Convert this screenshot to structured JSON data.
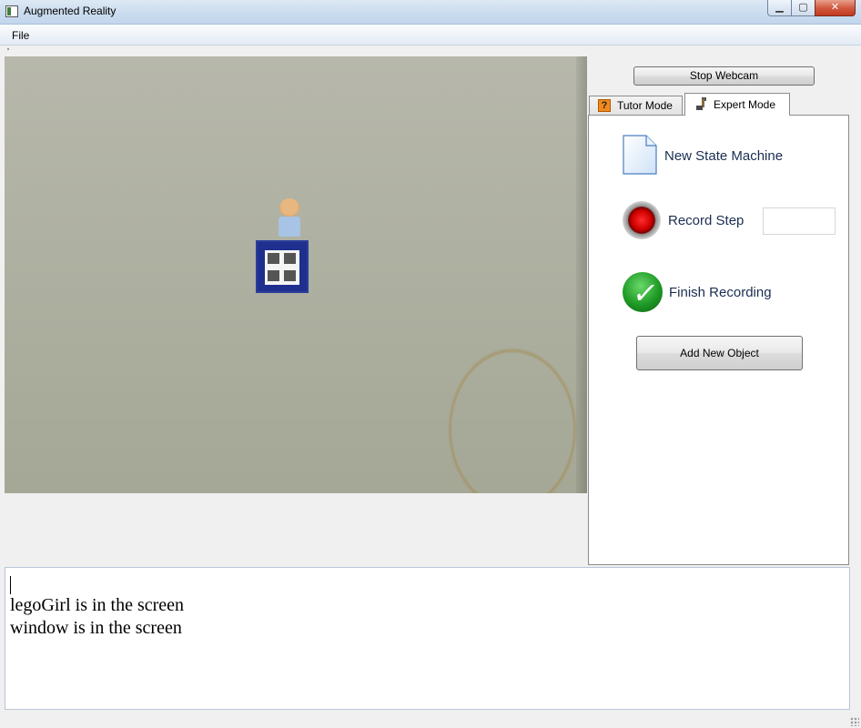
{
  "window": {
    "title": "Augmented Reality",
    "min_glyph": "▁",
    "max_glyph": "▢",
    "close_glyph": "✕"
  },
  "menu": {
    "items": [
      {
        "label": "File"
      }
    ]
  },
  "controls": {
    "stop_webcam_label": "Stop Webcam"
  },
  "tabs": [
    {
      "label": "Tutor Mode",
      "icon": "question-icon",
      "icon_glyph": "?",
      "selected": false
    },
    {
      "label": "Expert Mode",
      "icon": "tool-icon",
      "selected": true
    }
  ],
  "expert_panel": {
    "new_state_machine": {
      "label": "New State Machine",
      "icon": "document-icon"
    },
    "record_step": {
      "label": "Record Step",
      "icon": "record-icon",
      "input_value": ""
    },
    "finish_recording": {
      "label": "Finish Recording",
      "icon": "checkmark-icon",
      "icon_glyph": "✓"
    },
    "add_object_label": "Add New Object"
  },
  "log": {
    "lines": [
      "legoGirl is in the screen",
      "window is in the screen"
    ]
  },
  "colors": {
    "titlebar": "#c9dbee",
    "close_button": "#c23a22",
    "action_text": "#1b2e50",
    "record_red": "#d00000",
    "finish_green": "#1f9a25"
  }
}
